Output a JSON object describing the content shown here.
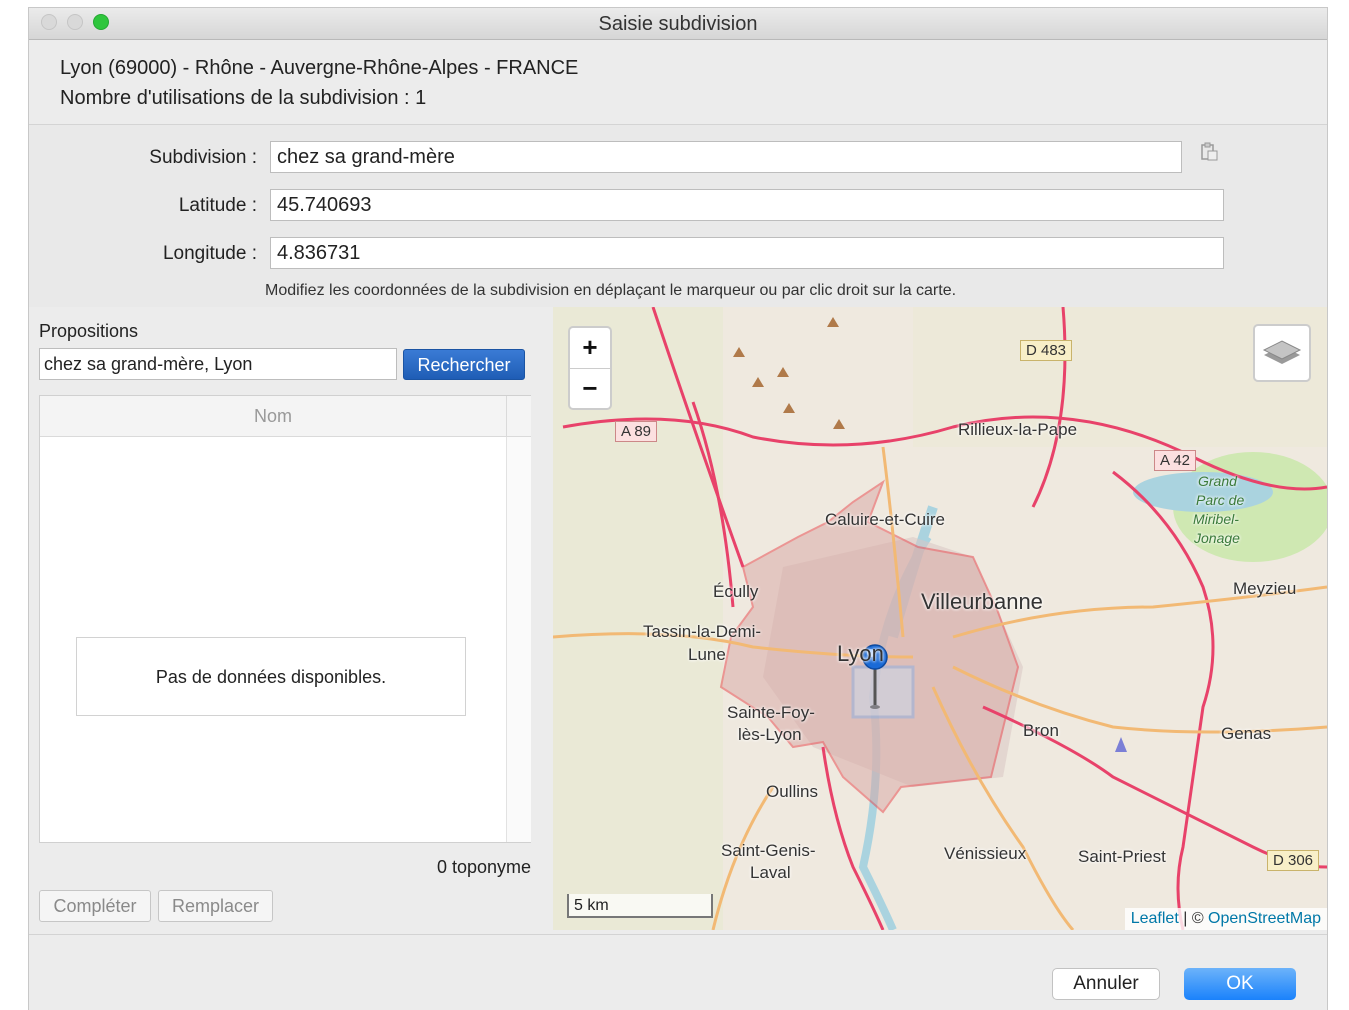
{
  "window": {
    "title": "Saisie subdivision"
  },
  "info": {
    "location": "Lyon (69000) - Rhône - Auvergne-Rhône-Alpes - FRANCE",
    "usage": "Nombre d'utilisations de la subdivision : 1"
  },
  "form": {
    "subdivision_label": "Subdivision :",
    "subdivision_value": "chez sa grand-mère",
    "latitude_label": "Latitude :",
    "latitude_value": "45.740693",
    "longitude_label": "Longitude :",
    "longitude_value": "4.836731",
    "hint": "Modifiez les coordonnées de la subdivision en déplaçant le marqueur ou par clic droit sur la carte."
  },
  "propositions": {
    "label": "Propositions",
    "search_value": "chez sa grand-mère, Lyon",
    "search_button": "Rechercher",
    "column_name": "Nom",
    "empty_text": "Pas de données disponibles.",
    "count_text": "0 toponyme",
    "complete_button": "Compléter",
    "replace_button": "Remplacer"
  },
  "map": {
    "zoom_in": "+",
    "zoom_out": "−",
    "scale": "5 km",
    "attribution_leaflet": "Leaflet",
    "attribution_sep": " | © ",
    "attribution_osm": "OpenStreetMap",
    "labels": {
      "rillieux": "Rillieux-la-Pape",
      "caluire": "Caluire-et-Cuire",
      "villeurbanne": "Villeurbanne",
      "ecully": "Écully",
      "tassin1": "Tassin-la-Demi-",
      "tassin2": "Lune",
      "lyon": "Lyon",
      "sainte_foy1": "Sainte-Foy-",
      "sainte_foy2": "lès-Lyon",
      "oullins": "Oullins",
      "saint_genis1": "Saint-Genis-",
      "saint_genis2": "Laval",
      "venissieux": "Vénissieux",
      "saint_priest": "Saint-Priest",
      "bron": "Bron",
      "genas": "Genas",
      "meyzieu": "Meyzieu",
      "miribel1": "Grand",
      "miribel2": "Parc de",
      "miribel3": "Miribel-",
      "miribel4": "Jonage"
    },
    "shields": {
      "d483": "D 483",
      "a89": "A 89",
      "a42": "A 42",
      "d306": "D 306"
    },
    "colors": {
      "boundary": "#e8434a",
      "motorway": "#e8426a",
      "primary": "#f2b974",
      "water": "#aad3df",
      "park": "#cfe8b2"
    }
  },
  "footer": {
    "cancel": "Annuler",
    "ok": "OK"
  }
}
